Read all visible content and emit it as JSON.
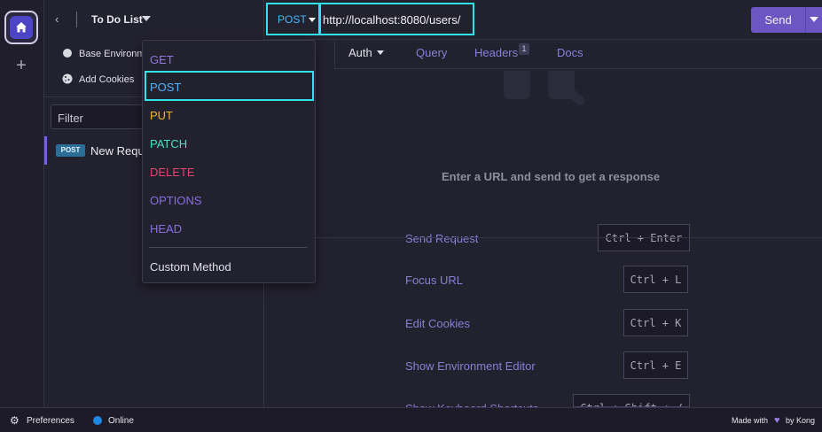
{
  "workspace": {
    "name": "To Do List"
  },
  "sidebar": {
    "environment_label": "Base Environm",
    "cookies_label": "Add Cookies",
    "filter_placeholder": "Filter",
    "requests": [
      {
        "method": "POST",
        "name": "New Requ"
      }
    ]
  },
  "request": {
    "method": "POST",
    "url": "http://localhost:8080/users/",
    "send_label": "Send"
  },
  "tabs": [
    {
      "label": "Auth"
    },
    {
      "label": "Query"
    },
    {
      "label": "Headers",
      "badge": "1"
    },
    {
      "label": "Docs"
    }
  ],
  "response": {
    "empty_message": "Enter a URL and send to get a response",
    "shortcuts": [
      {
        "label": "Send Request",
        "key": "Ctrl + Enter"
      },
      {
        "label": "Focus URL",
        "key": "Ctrl + L"
      },
      {
        "label": "Edit Cookies",
        "key": "Ctrl + K"
      },
      {
        "label": "Show Environment Editor",
        "key": "Ctrl + E"
      },
      {
        "label": "Show Keyboard Shortcuts",
        "key": "Ctrl + Shift + /"
      }
    ]
  },
  "method_menu": {
    "items": [
      {
        "label": "GET",
        "color": "#9175e0"
      },
      {
        "label": "POST",
        "color": "#4db4ff"
      },
      {
        "label": "PUT",
        "color": "#f4b334"
      },
      {
        "label": "PATCH",
        "color": "#48e0c4"
      },
      {
        "label": "DELETE",
        "color": "#e04672"
      },
      {
        "label": "OPTIONS",
        "color": "#8a6fe0"
      },
      {
        "label": "HEAD",
        "color": "#8a6fe0"
      }
    ],
    "custom_label": "Custom Method"
  },
  "status_bar": {
    "preferences_label": "Preferences",
    "online_label": "Online",
    "made_with_label": "Made with",
    "by_label": "by Kong"
  },
  "colors": {
    "accent": "#6c56c4",
    "highlight": "#2fe2ee",
    "online": "#1e88e5"
  },
  "icons": [
    "home-icon",
    "plus-icon",
    "chevron-left-icon",
    "caret-down-icon",
    "environment-dot-icon",
    "cookie-icon",
    "gear-icon",
    "heart-icon"
  ]
}
